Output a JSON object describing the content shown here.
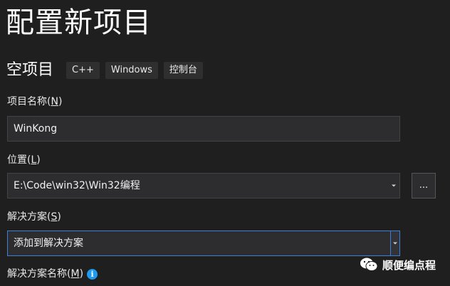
{
  "page_title": "配置新项目",
  "project_type": "空项目",
  "tags": [
    "C++",
    "Windows",
    "控制台"
  ],
  "project_name": {
    "label_text": "项目名称(",
    "label_key": "N",
    "label_close": ")",
    "value": "WinKong"
  },
  "location": {
    "label_text": "位置(",
    "label_key": "L",
    "label_close": ")",
    "value": "E:\\Code\\win32\\Win32编程",
    "browse_label": "..."
  },
  "solution": {
    "label_text": "解决方案(",
    "label_key": "S",
    "label_close": ")",
    "value": "添加到解决方案"
  },
  "solution_name": {
    "label_text": "解决方案名称(",
    "label_key": "M",
    "label_close": ")",
    "info_icon": "i"
  },
  "watermark": {
    "icon": "wechat-icon",
    "text": "顺便编点程"
  },
  "colors": {
    "background": "#1f1f1f",
    "field_bg": "#2d2d30",
    "focus_border": "#3d7fd4",
    "info_blue": "#1e9bf0"
  }
}
